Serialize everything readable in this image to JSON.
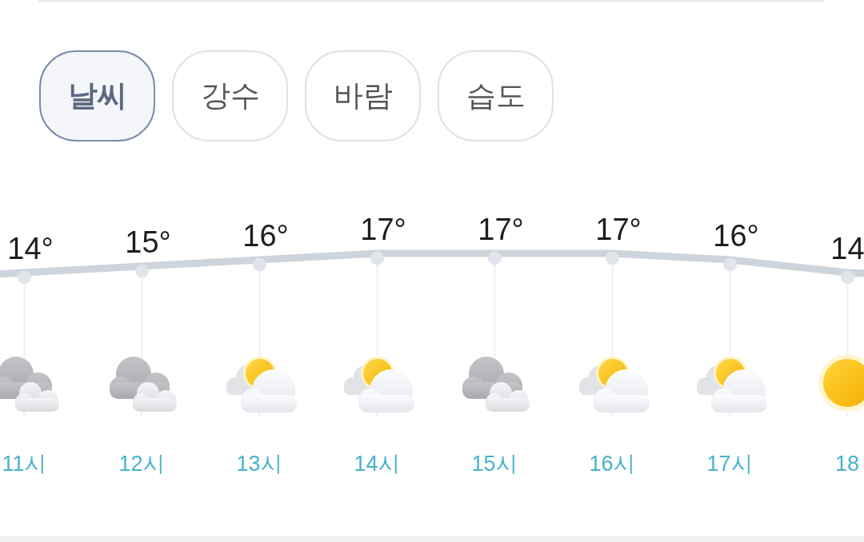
{
  "tabs": [
    {
      "label": "날씨",
      "selected": true
    },
    {
      "label": "강수",
      "selected": false
    },
    {
      "label": "바람",
      "selected": false
    },
    {
      "label": "습도",
      "selected": false
    }
  ],
  "hourly": {
    "chart_data": {
      "type": "line",
      "categories": [
        "11시",
        "12시",
        "13시",
        "14시",
        "15시",
        "16시",
        "17시",
        "18"
      ],
      "series": [
        {
          "color": "#cdd4dc",
          "values": [
            14,
            15,
            16,
            17,
            17,
            17,
            16,
            14
          ]
        }
      ],
      "grid": true,
      "data_labels": true
    },
    "hours": [
      {
        "kind": "cloudy",
        "unit": "°"
      },
      {
        "kind": "cloudy",
        "unit": "°"
      },
      {
        "kind": "partly_cloudy",
        "unit": "°"
      },
      {
        "kind": "partly_cloudy",
        "unit": "°"
      },
      {
        "kind": "cloudy",
        "unit": "°"
      },
      {
        "kind": "partly_cloudy",
        "unit": "°"
      },
      {
        "kind": "partly_cloudy",
        "unit": "°"
      },
      {
        "kind": "sunny"
      }
    ]
  }
}
